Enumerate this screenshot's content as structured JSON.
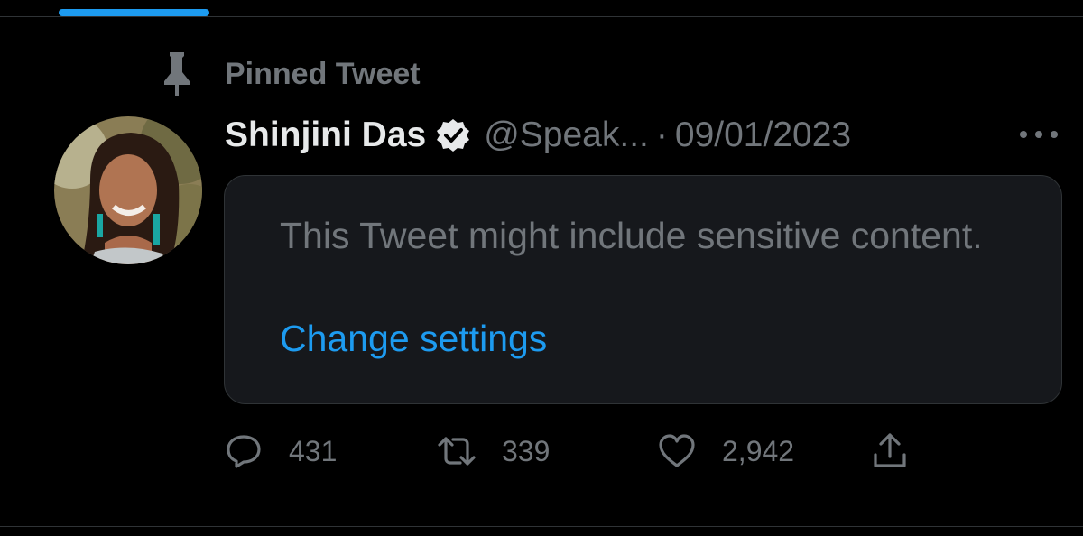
{
  "tweet": {
    "pinned_label": "Pinned Tweet",
    "author_name": "Shinjini Das",
    "handle": "@Speak...",
    "separator": "·",
    "date": "09/01/2023",
    "sensitive_warning": "This Tweet might include sensitive content.",
    "change_settings_link": "Change settings",
    "actions": {
      "reply_count": "431",
      "retweet_count": "339",
      "like_count": "2,942"
    }
  },
  "icons": {
    "pin": "pin-icon",
    "verified": "verified-badge-icon",
    "more": "more-options-icon",
    "reply": "reply-icon",
    "retweet": "retweet-icon",
    "like": "heart-icon",
    "share": "share-icon"
  },
  "colors": {
    "background": "#000000",
    "accent": "#1d9bf0",
    "primary_text": "#e7e9ea",
    "secondary_text": "#71767b",
    "card_background": "#16181c",
    "border": "#2f3336"
  }
}
